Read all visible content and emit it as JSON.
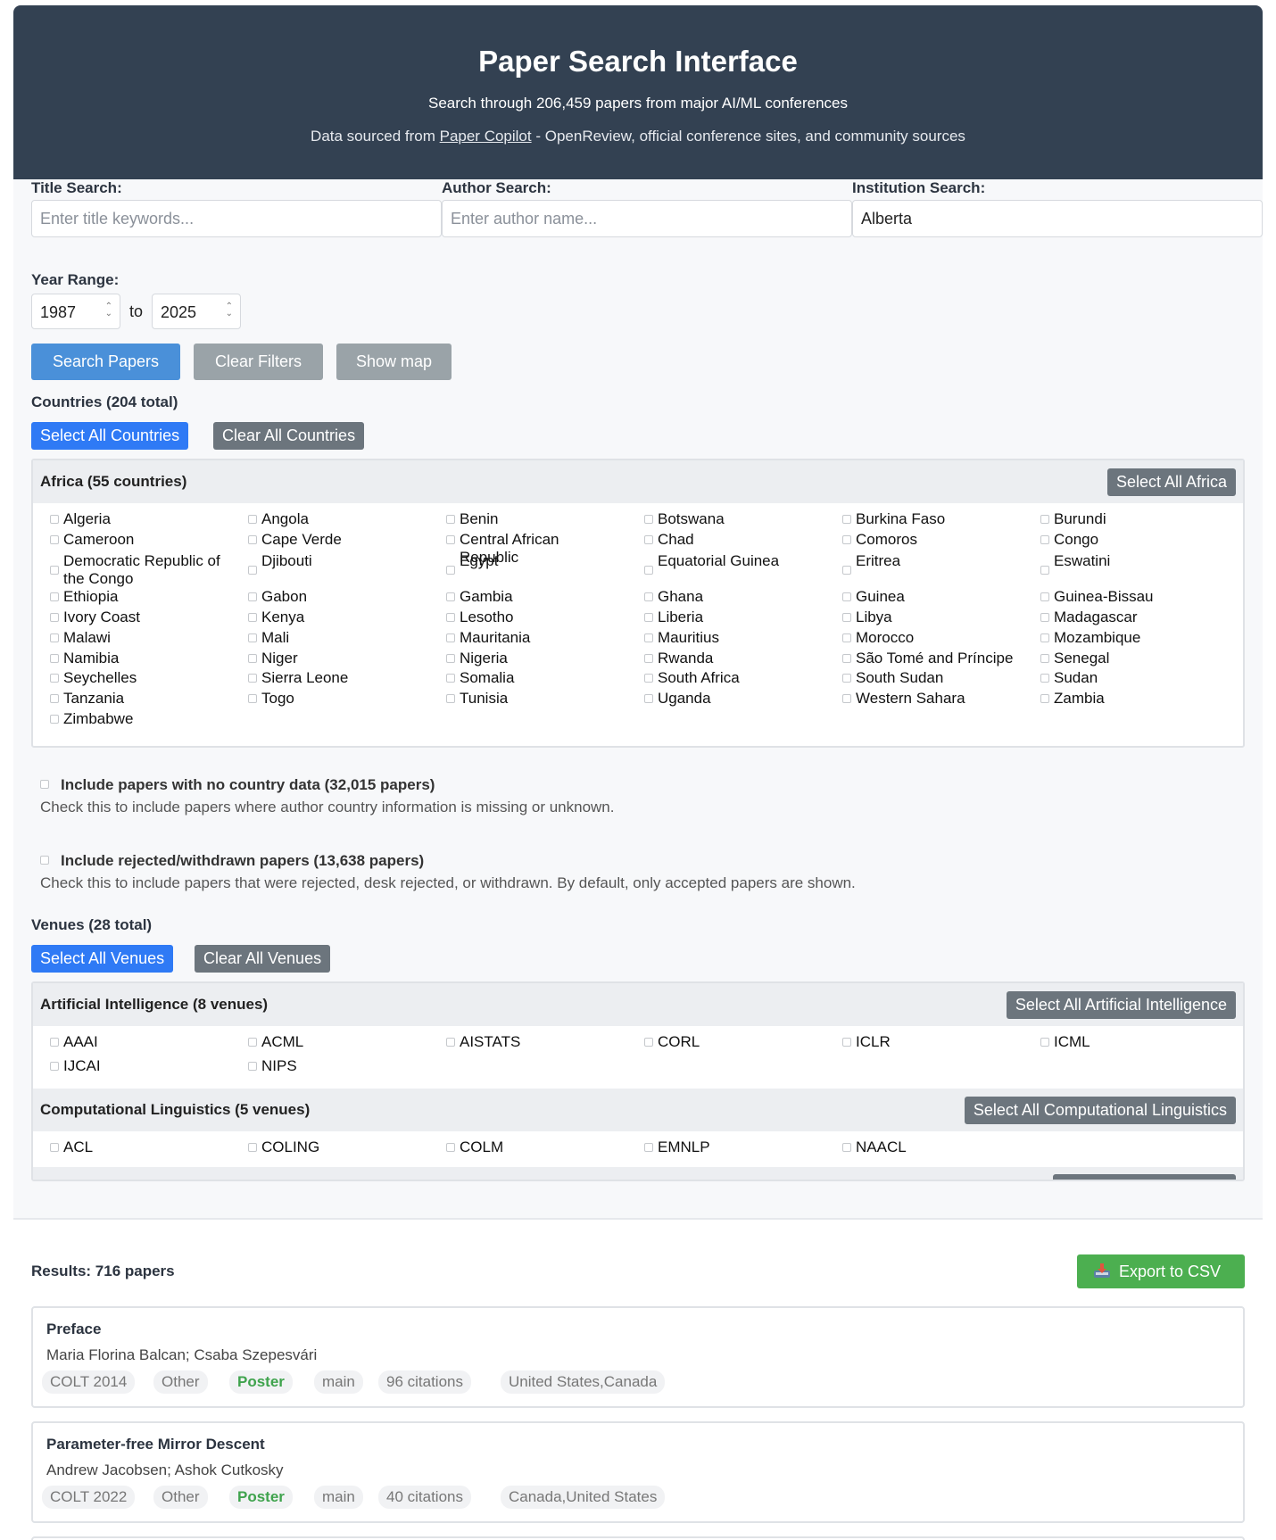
{
  "header": {
    "title": "Paper Search Interface",
    "subtitle": "Search through 206,459 papers from major AI/ML conferences",
    "source_prefix": "Data sourced from ",
    "source_link": "Paper Copilot",
    "source_suffix": " - OpenReview, official conference sites, and community sources"
  },
  "filters": {
    "title_label": "Title Search:",
    "title_placeholder": "Enter title keywords...",
    "title_value": "",
    "author_label": "Author Search:",
    "author_placeholder": "Enter author name...",
    "author_value": "",
    "institution_label": "Institution Search:",
    "institution_value": "Alberta",
    "year_label": "Year Range:",
    "year_from": "1987",
    "year_to_label": "to",
    "year_to": "2025",
    "search_button": "Search Papers",
    "clear_button": "Clear Filters",
    "map_button": "Show map"
  },
  "countries": {
    "title": "Countries (204 total)",
    "select_all": "Select All Countries",
    "clear_all": "Clear All Countries",
    "group_title": "Africa (55 countries)",
    "group_select": "Select All Africa",
    "items": [
      "Algeria",
      "Angola",
      "Benin",
      "Botswana",
      "Burkina Faso",
      "Burundi",
      "Cameroon",
      "Cape Verde",
      "Central African Republic",
      "Chad",
      "Comoros",
      "Congo",
      "Democratic Republic of the Congo",
      "Djibouti",
      "Egypt",
      "Equatorial Guinea",
      "Eritrea",
      "Eswatini",
      "Ethiopia",
      "Gabon",
      "Gambia",
      "Ghana",
      "Guinea",
      "Guinea-Bissau",
      "Ivory Coast",
      "Kenya",
      "Lesotho",
      "Liberia",
      "Libya",
      "Madagascar",
      "Malawi",
      "Mali",
      "Mauritania",
      "Mauritius",
      "Morocco",
      "Mozambique",
      "Namibia",
      "Niger",
      "Nigeria",
      "Rwanda",
      "São Tomé and Príncipe",
      "Senegal",
      "Seychelles",
      "Sierra Leone",
      "Somalia",
      "South Africa",
      "South Sudan",
      "Sudan",
      "Tanzania",
      "Togo",
      "Tunisia",
      "Uganda",
      "Western Sahara",
      "Zambia",
      "Zimbabwe"
    ]
  },
  "options": {
    "no_country_title": "Include papers with no country data (32,015 papers)",
    "no_country_desc": "Check this to include papers where author country information is missing or unknown.",
    "rejected_title": "Include rejected/withdrawn papers (13,638 papers)",
    "rejected_desc": "Check this to include papers that were rejected, desk rejected, or withdrawn. By default, only accepted papers are shown."
  },
  "venues": {
    "title": "Venues (28 total)",
    "select_all": "Select All Venues",
    "clear_all": "Clear All Venues",
    "groups": [
      {
        "title": "Artificial Intelligence (8 venues)",
        "select": "Select All Artificial Intelligence",
        "items": [
          "AAAI",
          "ACML",
          "AISTATS",
          "CORL",
          "ICLR",
          "ICML",
          "IJCAI",
          "NIPS"
        ]
      },
      {
        "title": "Computational Linguistics (5 venues)",
        "select": "Select All Computational Linguistics",
        "items": [
          "ACL",
          "COLING",
          "COLM",
          "EMNLP",
          "NAACL"
        ]
      }
    ]
  },
  "results": {
    "title": "Results: 716 papers",
    "export": "Export to CSV",
    "papers": [
      {
        "title": "Preface",
        "authors": "Maria Florina Balcan; Csaba Szepesvári",
        "tags": [
          "COLT 2014",
          "Other",
          "Poster",
          "main",
          "96 citations",
          "United States,Canada"
        ]
      },
      {
        "title": "Parameter-free Mirror Descent",
        "authors": "Andrew Jacobsen; Ashok Cutkosky",
        "tags": [
          "COLT 2022",
          "Other",
          "Poster",
          "main",
          "40 citations",
          "Canada,United States"
        ]
      }
    ]
  }
}
